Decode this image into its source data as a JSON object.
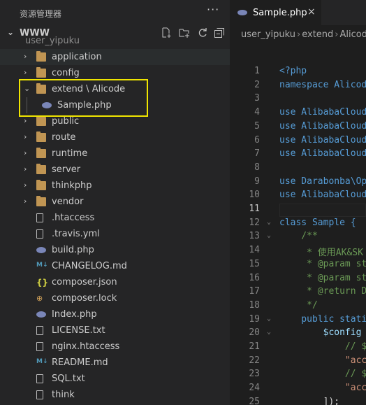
{
  "sidebar": {
    "title": "资源管理器",
    "more_label": "···",
    "workspace": "WWW",
    "actions": [
      "new-file",
      "new-folder",
      "refresh",
      "collapse-all"
    ],
    "partial_top": "user_yipuku",
    "items": [
      {
        "label": "application",
        "type": "folder",
        "chevron": "›"
      },
      {
        "label": "config",
        "type": "folder",
        "chevron": "›"
      },
      {
        "label": "extend \\ Alicode",
        "type": "folder-open",
        "chevron": "⌄"
      },
      {
        "label": "Sample.php",
        "type": "php"
      },
      {
        "label": "public",
        "type": "folder",
        "chevron": "›"
      },
      {
        "label": "route",
        "type": "folder",
        "chevron": "›"
      },
      {
        "label": "runtime",
        "type": "folder",
        "chevron": "›"
      },
      {
        "label": "server",
        "type": "folder",
        "chevron": "›"
      },
      {
        "label": "thinkphp",
        "type": "folder",
        "chevron": "›"
      },
      {
        "label": "vendor",
        "type": "folder",
        "chevron": "›"
      },
      {
        "label": ".htaccess",
        "type": "file"
      },
      {
        "label": ".travis.yml",
        "type": "file"
      },
      {
        "label": "build.php",
        "type": "php"
      },
      {
        "label": "CHANGELOG.md",
        "type": "md"
      },
      {
        "label": "composer.json",
        "type": "json"
      },
      {
        "label": "composer.lock",
        "type": "lock"
      },
      {
        "label": "Index.php",
        "type": "php"
      },
      {
        "label": "LICENSE.txt",
        "type": "file"
      },
      {
        "label": "nginx.htaccess",
        "type": "file"
      },
      {
        "label": "README.md",
        "type": "md"
      },
      {
        "label": "SQL.txt",
        "type": "file"
      },
      {
        "label": "think",
        "type": "file"
      }
    ]
  },
  "editor": {
    "tab_label": "Sample.php",
    "tab_close": "×",
    "breadcrumbs": [
      "user_yipuku",
      "extend",
      "Alicode"
    ],
    "current_line": 11,
    "lines": [
      {
        "n": "1",
        "text": "<?php"
      },
      {
        "n": "2",
        "text": "namespace Alicode"
      },
      {
        "n": "3",
        "text": ""
      },
      {
        "n": "4",
        "text": "use AlibabaCloud"
      },
      {
        "n": "5",
        "text": "use AlibabaCloud"
      },
      {
        "n": "6",
        "text": "use AlibabaCloud"
      },
      {
        "n": "7",
        "text": "use AlibabaCloud"
      },
      {
        "n": "8",
        "text": ""
      },
      {
        "n": "9",
        "text": "use Darabonba\\Op"
      },
      {
        "n": "10",
        "text": "use AlibabaCloud"
      },
      {
        "n": "11",
        "text": ""
      },
      {
        "n": "12",
        "text": "class Sample {"
      },
      {
        "n": "13",
        "text": "    /**"
      },
      {
        "n": "14",
        "text": "     * 使用AK&SK"
      },
      {
        "n": "15",
        "text": "     * @param st"
      },
      {
        "n": "16",
        "text": "     * @param st"
      },
      {
        "n": "17",
        "text": "     * @return D"
      },
      {
        "n": "18",
        "text": "     */"
      },
      {
        "n": "19",
        "text": "    public stati"
      },
      {
        "n": "20",
        "text": "        $config"
      },
      {
        "n": "21",
        "text": "            // $"
      },
      {
        "n": "22",
        "text": "            \"acc"
      },
      {
        "n": "23",
        "text": "            // $"
      },
      {
        "n": "24",
        "text": "            \"acc"
      },
      {
        "n": "25",
        "text": "        ]);"
      }
    ]
  }
}
